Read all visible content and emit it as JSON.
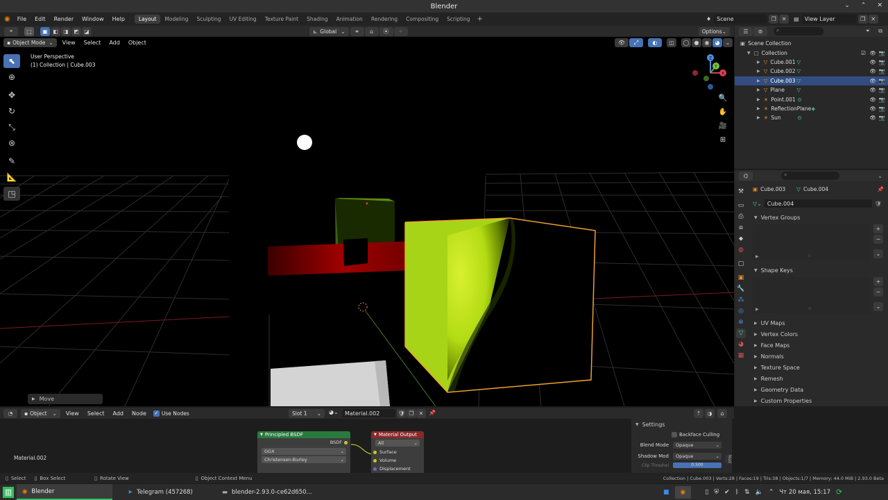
{
  "window": {
    "title": "Blender"
  },
  "menus": [
    "File",
    "Edit",
    "Render",
    "Window",
    "Help"
  ],
  "workspaces": [
    "Layout",
    "Modeling",
    "Sculpting",
    "UV Editing",
    "Texture Paint",
    "Shading",
    "Animation",
    "Rendering",
    "Compositing",
    "Scripting"
  ],
  "active_workspace": "Layout",
  "scene": {
    "scene_name": "Scene",
    "view_layer": "View Layer"
  },
  "toolbar": {
    "orientation": "Global",
    "options": "Options"
  },
  "viewport_header": {
    "mode": "Object Mode",
    "menu": [
      "View",
      "Select",
      "Add",
      "Object"
    ]
  },
  "viewport": {
    "perspective_label": "User Perspective",
    "collection_label": "(1) Collection | Cube.003",
    "operator_panel": "Move",
    "gizmo_axes": {
      "x": "X",
      "y": "Y",
      "z": "Z"
    }
  },
  "outliner": {
    "root": "Scene Collection",
    "collection": "Collection",
    "items": [
      {
        "name": "Cube.001",
        "selected": false,
        "icon": "mesh-icon"
      },
      {
        "name": "Cube.002",
        "selected": false,
        "icon": "mesh-icon"
      },
      {
        "name": "Cube.003",
        "selected": true,
        "icon": "mesh-icon"
      },
      {
        "name": "Plane",
        "selected": false,
        "icon": "mesh-icon"
      },
      {
        "name": "Point.001",
        "selected": false,
        "icon": "light-icon"
      },
      {
        "name": "ReflectionPlane",
        "selected": false,
        "icon": "probe-icon"
      },
      {
        "name": "Sun",
        "selected": false,
        "icon": "light-icon"
      }
    ]
  },
  "properties": {
    "breadcrumb_object": "Cube.003",
    "breadcrumb_mesh": "Cube.004",
    "mesh_name": "Cube.004",
    "sections_open": [
      "Vertex Groups",
      "Shape Keys"
    ],
    "sections_closed": [
      "UV Maps",
      "Vertex Colors",
      "Face Maps",
      "Normals",
      "Texture Space",
      "Remesh",
      "Geometry Data",
      "Custom Properties"
    ]
  },
  "node_editor": {
    "type": "Object",
    "menu": [
      "View",
      "Select",
      "Add",
      "Node"
    ],
    "use_nodes": "Use Nodes",
    "slot": "Slot 1",
    "material": "Material.002",
    "material_label": "Material.002",
    "bsdf_node": {
      "title": "Principled BSDF",
      "output": "BSDF",
      "distribution": "GGX",
      "subsurface": "Christensen-Burley"
    },
    "output_node": {
      "title": "Material Output",
      "target": "All",
      "inputs": [
        "Surface",
        "Volume",
        "Displacement"
      ]
    },
    "settings": {
      "title": "Settings",
      "backface": "Backface Culling",
      "blend_label": "Blend Mode",
      "blend_value": "Opaque",
      "shadow_label": "Shadow Mod",
      "shadow_value": "Opaque",
      "clip_label": "Clip Threshol",
      "clip_value": "0.500",
      "tab": "Nod"
    }
  },
  "statusbar": {
    "select": "Select",
    "box_select": "Box Select",
    "rotate": "Rotate View",
    "context": "Object Context Menu",
    "info": "Collection | Cube.003 | Verts:28 | Faces:19 | Tris:38 | Objects:1/7 | Memory: 44.0 MiB | 2.93.0 Beta"
  },
  "taskbar": {
    "apps": [
      {
        "label": "Blender",
        "active": true
      },
      {
        "label": "Telegram (457268)",
        "active": false
      },
      {
        "label": "blender-2.93.0-ce62d650...",
        "active": false
      }
    ],
    "clock": "Чт 20 мая, 15:17"
  },
  "colors": {
    "accent": "#4772b3",
    "selected_row": "#334d80",
    "cube_yellow": "#b8e21a",
    "outline": "#f0a030"
  }
}
